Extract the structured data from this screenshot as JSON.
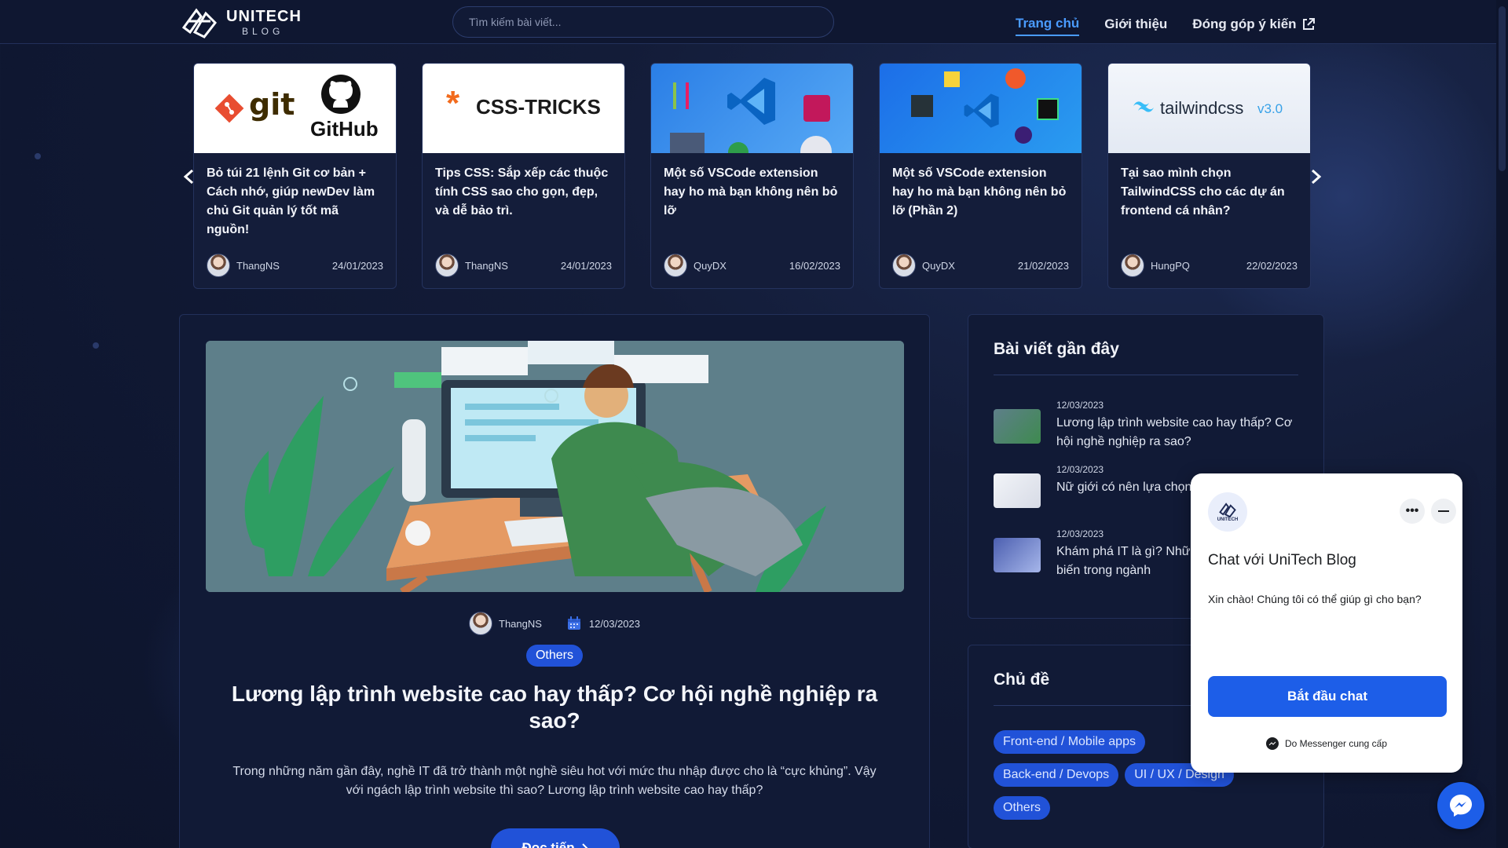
{
  "header": {
    "logo_title": "UNITECH",
    "logo_sub": "BLOG",
    "search_placeholder": "Tìm kiếm bài viết...",
    "nav": [
      {
        "label": "Trang chủ",
        "active": true
      },
      {
        "label": "Giới thiệu",
        "active": false
      },
      {
        "label": "Đóng góp ý kiến",
        "active": false,
        "icon": "external-link-icon"
      }
    ]
  },
  "carousel": {
    "cards": [
      {
        "thumb": "git-github-logo",
        "title": "Bỏ túi 21 lệnh Git cơ bản + Cách nhớ, giúp newDev làm chủ Git quản lý tốt mã nguồn!",
        "author": "ThangNS",
        "date": "24/01/2023"
      },
      {
        "thumb": "css-tricks-logo",
        "title": "Tips CSS: Sắp xếp các thuộc tính CSS sao cho gọn, đẹp, và dễ bảo trì.",
        "author": "ThangNS",
        "date": "24/01/2023"
      },
      {
        "thumb": "vscode-extensions-1",
        "title": "Một số VSCode extension hay ho mà bạn không nên bỏ lỡ",
        "author": "QuyDX",
        "date": "16/02/2023"
      },
      {
        "thumb": "vscode-extensions-2",
        "title": "Một số VSCode extension hay ho mà bạn không nên bỏ lỡ (Phần 2)",
        "author": "QuyDX",
        "date": "21/02/2023"
      },
      {
        "thumb": "tailwindcss-logo",
        "title": "Tại sao mình chọn TailwindCSS cho các dự án frontend cá nhân?",
        "author": "HungPQ",
        "date": "22/02/2023"
      }
    ],
    "thumb_labels": {
      "git": "git",
      "github": "GitHub",
      "css": "CSS-TRICKS",
      "tailwind": "tailwindcss",
      "tailwind_ver": "v3.0"
    }
  },
  "article": {
    "author": "ThangNS",
    "date": "12/03/2023",
    "tag": "Others",
    "title": "Lương lập trình website cao hay thấp? Cơ hội nghề nghiệp ra sao?",
    "excerpt": "Trong những năm gần đây, nghề IT đã trở thành một nghề siêu hot với mức thu nhập được cho là “cực khủng”. Vậy với ngách lập trình website thì sao? Lương lập trình website cao hay thấp?",
    "read_more": "Đọc tiếp"
  },
  "recent": {
    "heading": "Bài viết gần đây",
    "items": [
      {
        "date": "12/03/2023",
        "title": "Lương lập trình website cao hay thấp? Cơ hội nghề nghiệp ra sao?"
      },
      {
        "date": "12/03/2023",
        "title": "Nữ giới có nên lựa chọn ngành IT không?"
      },
      {
        "date": "12/03/2023",
        "title": "Khám phá IT là gì? Những ngành IT phổ biến trong ngành"
      }
    ]
  },
  "topics": {
    "heading": "Chủ đề",
    "items": [
      "Front-end / Mobile apps",
      "Back-end / Devops",
      "UI / UX / Design",
      "Others"
    ]
  },
  "chat": {
    "logo_text": "UNITECH",
    "title": "Chat với UniTech Blog",
    "message": "Xin chào! Chúng tôi có thể giúp gì cho bạn?",
    "start_button": "Bắt đầu chat",
    "footer": "Do Messenger cung cấp"
  },
  "colors": {
    "accent": "#2152d8",
    "nav_active": "#4a9bff",
    "background": "#0f1731"
  }
}
